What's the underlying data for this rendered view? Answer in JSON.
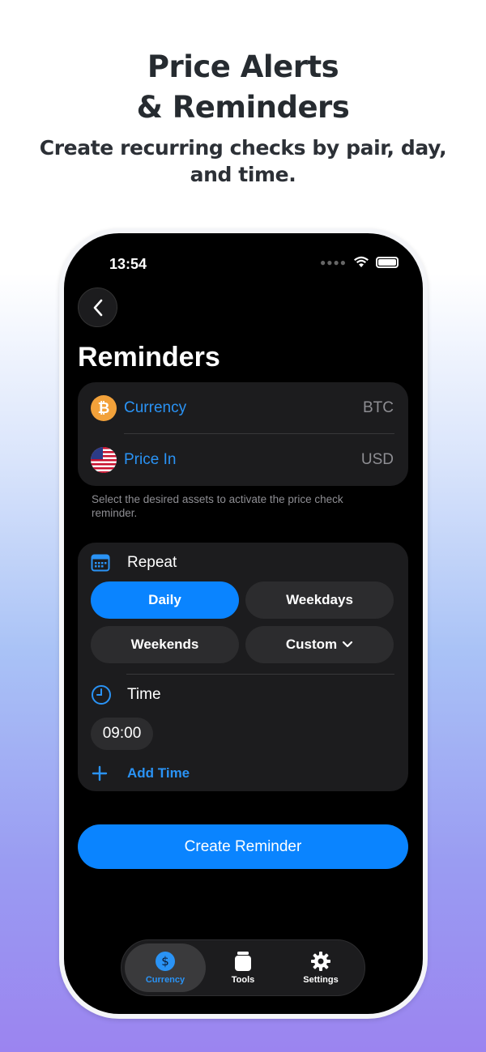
{
  "hero": {
    "title_line1": "Price Alerts",
    "title_line2": "& Reminders",
    "subtitle": "Create recurring checks by pair, day, and time."
  },
  "status_bar": {
    "time": "13:54"
  },
  "page": {
    "title": "Reminders"
  },
  "assets": {
    "currency_label": "Currency",
    "currency_value": "BTC",
    "price_in_label": "Price In",
    "price_in_value": "USD",
    "help_text": "Select the desired assets to activate the price check reminder."
  },
  "repeat": {
    "label": "Repeat",
    "options": [
      "Daily",
      "Weekdays",
      "Weekends",
      "Custom"
    ],
    "selected": "Daily"
  },
  "time": {
    "label": "Time",
    "entries": [
      "09:00"
    ],
    "add_label": "Add Time"
  },
  "actions": {
    "create_label": "Create Reminder"
  },
  "tabbar": {
    "tabs": [
      {
        "label": "Currency",
        "icon": "dollar-circle-icon",
        "active": true
      },
      {
        "label": "Tools",
        "icon": "tools-icon",
        "active": false
      },
      {
        "label": "Settings",
        "icon": "gear-icon",
        "active": false
      }
    ]
  },
  "colors": {
    "accent": "#0a84ff",
    "link": "#2a93f5",
    "card": "#1c1c1e",
    "pill": "#2c2c2e"
  }
}
